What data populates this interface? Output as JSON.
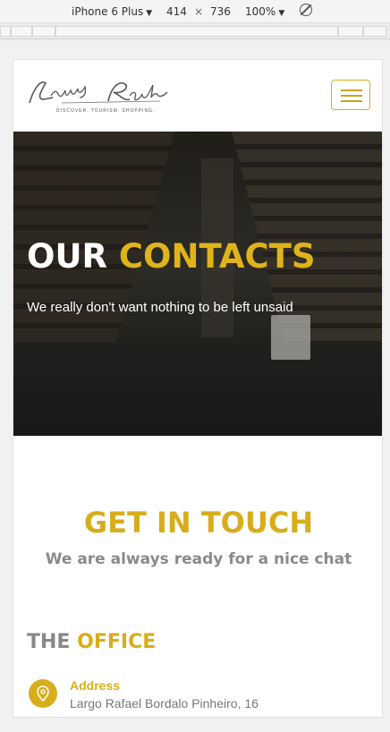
{
  "devtools": {
    "device": "iPhone 6 Plus",
    "width": "414",
    "times": "×",
    "height": "736",
    "zoom": "100%"
  },
  "site": {
    "logo_text": "Luxury Route",
    "tagline": "DISCOVER. TOURISM. SHOPPING."
  },
  "hero": {
    "title_part1": "OUR",
    "title_part2": "CONTACTS",
    "subtitle": "We really don't want nothing to be left unsaid"
  },
  "touch": {
    "title": "GET IN TOUCH",
    "subtitle": "We are always ready for a nice chat"
  },
  "office": {
    "title_part1": "THE",
    "title_part2": "OFFICE",
    "address_label": "Address",
    "address_value": "Largo Rafael Bordalo Pinheiro, 16"
  },
  "colors": {
    "accent": "#d8ad1c",
    "muted": "#888888"
  },
  "icons": {
    "menu": "hamburger-icon",
    "address": "map-pin-icon",
    "rotate": "rotate-icon"
  }
}
